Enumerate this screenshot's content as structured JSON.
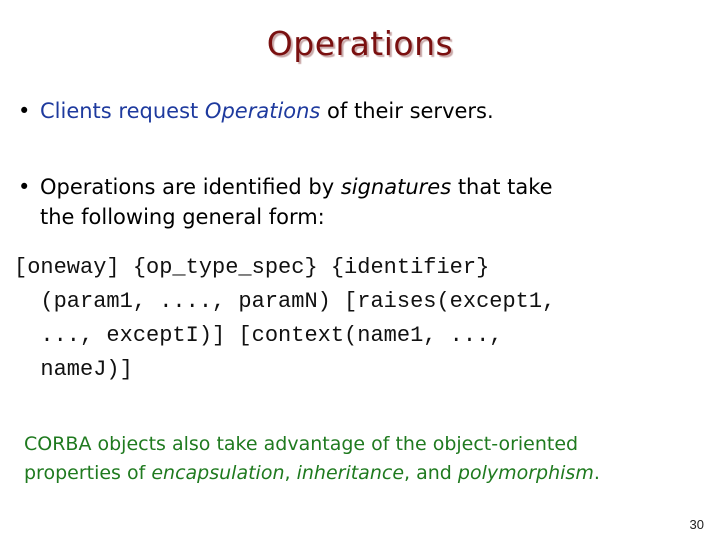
{
  "title": "Operations",
  "bullets": [
    {
      "marker": "•",
      "part1": "Clients request ",
      "part2_italic": "Operations",
      "part3": " of their servers."
    },
    {
      "marker": "•",
      "part1": "Operations are identified by ",
      "part2_italic": "signatures",
      "part3": " that take",
      "line2": "the following general form:"
    }
  ],
  "code_lines": [
    "[oneway] {op_type_spec} {identifier}",
    "  (param1, ...., paramN) [raises(except1,",
    "  ..., exceptI)] [context(name1, ...,",
    "  nameJ)]"
  ],
  "note": {
    "line1_start": "CORBA objects also take advantage of the object-oriented",
    "line2_start": "properties of ",
    "encapsulation": "encapsulation",
    "sep1": ", ",
    "inheritance": "inheritance",
    "sep2": ", and ",
    "polymorphism": "polymorphism",
    "end": "."
  },
  "page_number": "30",
  "colors": {
    "title": "#7a1010",
    "bullet1_highlight": "#1e3a9e",
    "note": "#1f7a1f"
  }
}
